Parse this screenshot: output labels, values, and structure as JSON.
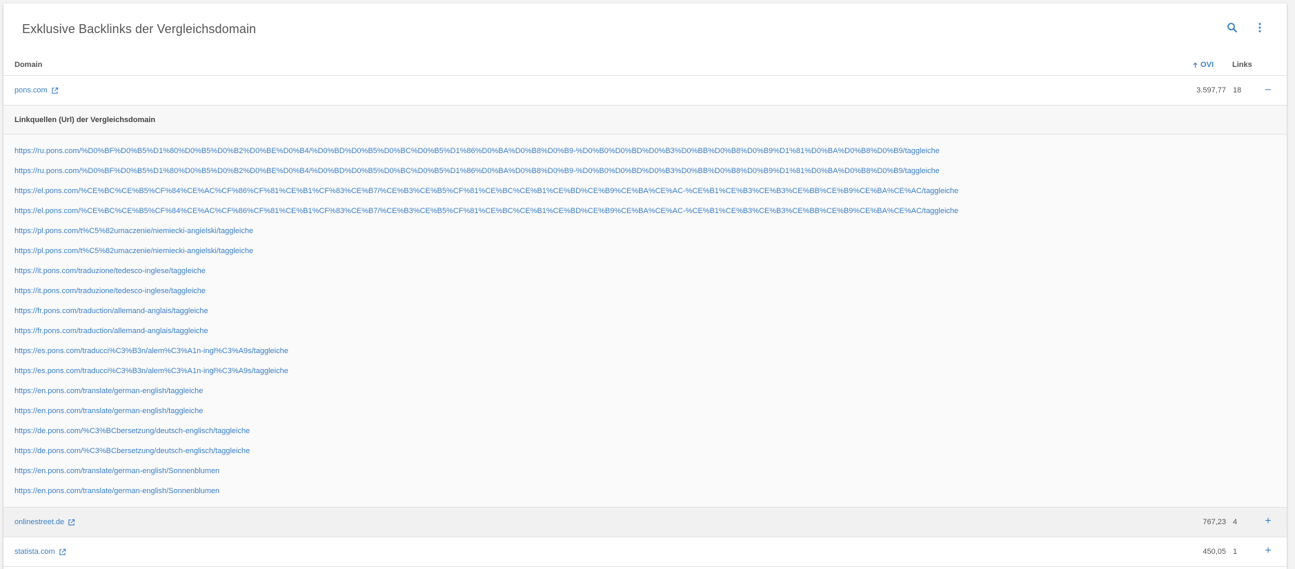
{
  "header": {
    "title": "Exklusive Backlinks der Vergleichsdomain"
  },
  "icons": {
    "search": "search-icon",
    "more": "more-vert-icon",
    "external": "external-link-icon",
    "sort": "arrow-up-icon"
  },
  "colors": {
    "accent": "#3a7fc7",
    "text": "#424242",
    "expanded_bg": "#fafafa",
    "collapsed_bg": "#f1f1f1"
  },
  "table": {
    "columns": {
      "domain": "Domain",
      "ovi": "OVI",
      "links": "Links"
    },
    "rows": [
      {
        "domain": "pons.com",
        "ovi": "3.597,77",
        "links": "18",
        "toggle": "–"
      },
      {
        "domain": "onlinestreet.de",
        "ovi": "767,23",
        "links": "4",
        "toggle": "+"
      },
      {
        "domain": "statista.com",
        "ovi": "450,05",
        "links": "1",
        "toggle": "+"
      }
    ]
  },
  "sources": {
    "header": "Linkquellen (Url) der Vergleichsdomain",
    "urls": [
      "https://ru.pons.com/%D0%BF%D0%B5%D1%80%D0%B5%D0%B2%D0%BE%D0%B4/%D0%BD%D0%B5%D0%BC%D0%B5%D1%86%D0%BA%D0%B8%D0%B9-%D0%B0%D0%BD%D0%B3%D0%BB%D0%B8%D0%B9%D1%81%D0%BA%D0%B8%D0%B9/taggleiche",
      "https://ru.pons.com/%D0%BF%D0%B5%D1%80%D0%B5%D0%B2%D0%BE%D0%B4/%D0%BD%D0%B5%D0%BC%D0%B5%D1%86%D0%BA%D0%B8%D0%B9-%D0%B0%D0%BD%D0%B3%D0%BB%D0%B8%D0%B9%D1%81%D0%BA%D0%B8%D0%B9/taggleiche",
      "https://el.pons.com/%CE%BC%CE%B5%CF%84%CE%AC%CF%86%CF%81%CE%B1%CF%83%CE%B7/%CE%B3%CE%B5%CF%81%CE%BC%CE%B1%CE%BD%CE%B9%CE%BA%CE%AC-%CE%B1%CE%B3%CE%B3%CE%BB%CE%B9%CE%BA%CE%AC/taggleiche",
      "https://el.pons.com/%CE%BC%CE%B5%CF%84%CE%AC%CF%86%CF%81%CE%B1%CF%83%CE%B7/%CE%B3%CE%B5%CF%81%CE%BC%CE%B1%CE%BD%CE%B9%CE%BA%CE%AC-%CE%B1%CE%B3%CE%B3%CE%BB%CE%B9%CE%BA%CE%AC/taggleiche",
      "https://pl.pons.com/t%C5%82umaczenie/niemiecki-angielski/taggleiche",
      "https://pl.pons.com/t%C5%82umaczenie/niemiecki-angielski/taggleiche",
      "https://it.pons.com/traduzione/tedesco-inglese/taggleiche",
      "https://it.pons.com/traduzione/tedesco-inglese/taggleiche",
      "https://fr.pons.com/traduction/allemand-anglais/taggleiche",
      "https://fr.pons.com/traduction/allemand-anglais/taggleiche",
      "https://es.pons.com/traducci%C3%B3n/alem%C3%A1n-ingl%C3%A9s/taggleiche",
      "https://es.pons.com/traducci%C3%B3n/alem%C3%A1n-ingl%C3%A9s/taggleiche",
      "https://en.pons.com/translate/german-english/taggleiche",
      "https://en.pons.com/translate/german-english/taggleiche",
      "https://de.pons.com/%C3%BCbersetzung/deutsch-englisch/taggleiche",
      "https://de.pons.com/%C3%BCbersetzung/deutsch-englisch/taggleiche",
      "https://en.pons.com/translate/german-english/Sonnenblumen",
      "https://en.pons.com/translate/german-english/Sonnenblumen"
    ]
  }
}
